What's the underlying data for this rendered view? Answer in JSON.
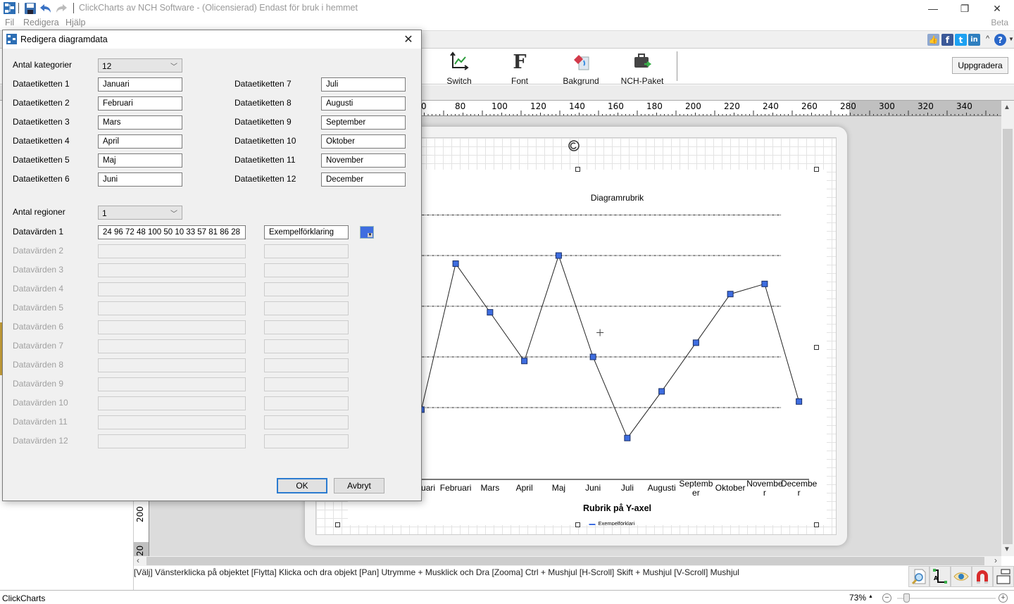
{
  "window": {
    "title": "ClickCharts av NCH Software - (Olicensierad) Endast för bruk i hemmet",
    "minimize": "—",
    "restore": "❐",
    "close": "✕",
    "beta": "Beta"
  },
  "menu": [
    "Fil",
    "Redigera",
    "Hjälp"
  ],
  "social": {
    "like": "👍",
    "facebook": "f",
    "twitter": "t",
    "linkedin": "in",
    "caret": "^",
    "help": "?"
  },
  "ribbon": {
    "buttons": [
      {
        "label": "Switch",
        "icon": "switch-axes-icon"
      },
      {
        "label": "Font",
        "icon": "font-icon"
      },
      {
        "label": "Bakgrund",
        "icon": "background-paint-icon"
      },
      {
        "label": "NCH-Paket",
        "icon": "nch-suite-icon"
      }
    ],
    "upgrade": "Uppgradera"
  },
  "ruler": {
    "h_ticks": [
      "0",
      "80",
      "100",
      "120",
      "140",
      "160",
      "180",
      "200",
      "220",
      "240",
      "260",
      "280",
      "300",
      "320",
      "340"
    ],
    "v_ticks": [
      "200",
      "20"
    ]
  },
  "dialog": {
    "title": "Redigera diagramdata",
    "close": "✕",
    "categories_label": "Antal kategorier",
    "categories_value": "12",
    "labels_left": [
      {
        "label": "Dataetiketten 1",
        "value": "Januari"
      },
      {
        "label": "Dataetiketten 2",
        "value": "Februari"
      },
      {
        "label": "Dataetiketten 3",
        "value": "Mars"
      },
      {
        "label": "Dataetiketten 4",
        "value": "April"
      },
      {
        "label": "Dataetiketten 5",
        "value": "Maj"
      },
      {
        "label": "Dataetiketten 6",
        "value": "Juni"
      }
    ],
    "labels_right": [
      {
        "label": "Dataetiketten 7",
        "value": "Juli"
      },
      {
        "label": "Dataetiketten 8",
        "value": "Augusti"
      },
      {
        "label": "Dataetiketten 9",
        "value": "September"
      },
      {
        "label": "Dataetiketten 10",
        "value": "Oktober"
      },
      {
        "label": "Dataetiketten 11",
        "value": "November"
      },
      {
        "label": "Dataetiketten 12",
        "value": "December"
      }
    ],
    "regions_label": "Antal regioner",
    "regions_value": "1",
    "series": [
      {
        "label": "Datavärden 1",
        "values": "24 96 72 48 100 50 10 33 57 81 86 28",
        "legend": "Exempelförklaring",
        "enabled": true,
        "color": "#3e6de0"
      },
      {
        "label": "Datavärden 2",
        "values": "",
        "legend": "",
        "enabled": false
      },
      {
        "label": "Datavärden 3",
        "values": "",
        "legend": "",
        "enabled": false
      },
      {
        "label": "Datavärden 4",
        "values": "",
        "legend": "",
        "enabled": false
      },
      {
        "label": "Datavärden 5",
        "values": "",
        "legend": "",
        "enabled": false
      },
      {
        "label": "Datavärden 6",
        "values": "",
        "legend": "",
        "enabled": false
      },
      {
        "label": "Datavärden 7",
        "values": "",
        "legend": "",
        "enabled": false
      },
      {
        "label": "Datavärden 8",
        "values": "",
        "legend": "",
        "enabled": false
      },
      {
        "label": "Datavärden 9",
        "values": "",
        "legend": "",
        "enabled": false
      },
      {
        "label": "Datavärden 10",
        "values": "",
        "legend": "",
        "enabled": false
      },
      {
        "label": "Datavärden 11",
        "values": "",
        "legend": "",
        "enabled": false
      },
      {
        "label": "Datavärden 12",
        "values": "",
        "legend": "",
        "enabled": false
      }
    ],
    "ok": "OK",
    "cancel": "Avbryt"
  },
  "chart_data": {
    "type": "line",
    "title": "Diagramrubrik",
    "xlabel": "Rubrik på Y-axel",
    "ylabel": "",
    "categories": [
      "Januari",
      "Februari",
      "Mars",
      "April",
      "Maj",
      "Juni",
      "Juli",
      "Augusti",
      "September",
      "Oktober",
      "November",
      "December"
    ],
    "category_display": [
      "Januari",
      "Februari",
      "Mars",
      "April",
      "Maj",
      "Juni",
      "Juli",
      "Augusti",
      "Septemb\ner",
      "Oktober",
      "Novembe\nr",
      "Decembe\nr"
    ],
    "series": [
      {
        "name": "Exempelförklaring",
        "values": [
          24,
          96,
          72,
          48,
          100,
          50,
          10,
          33,
          57,
          81,
          86,
          28
        ],
        "color": "#3e6de0"
      }
    ],
    "ylim": [
      0,
      125
    ],
    "gridlines": [
      25,
      50,
      75,
      100,
      125
    ],
    "grid": true,
    "legend": "bottom",
    "legend_label": "Exempelförklari\nng",
    "marker": "square"
  },
  "status": {
    "hint": "[Välj] Vänsterklicka på objektet [Flytta] Klicka och dra objekt [Pan] Utrymme + Musklick och Dra [Zooma] Ctrl + Mushjul [H-Scroll] Skift + Mushjul [V-Scroll] Mushjul",
    "app_name": "ClickCharts",
    "zoom": "73%",
    "zoom_caret": "▲",
    "zoom_out": "−",
    "zoom_in": "+"
  }
}
